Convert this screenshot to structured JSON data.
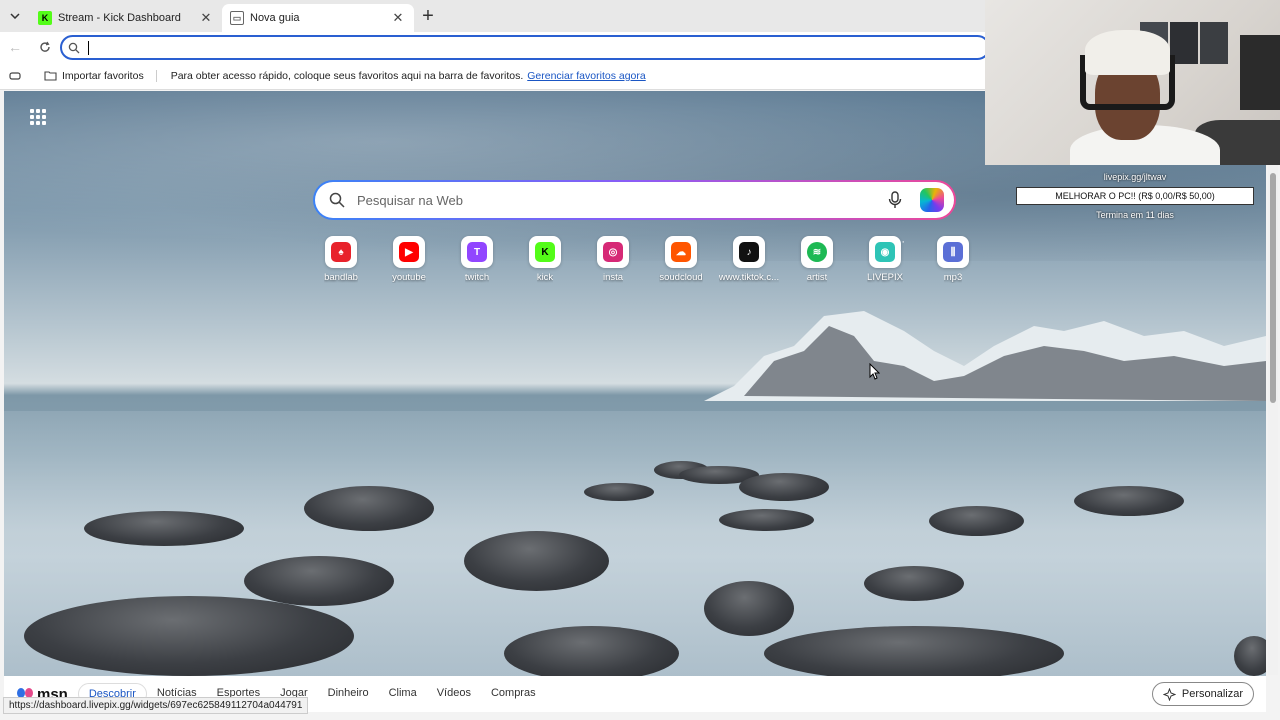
{
  "tabs": [
    {
      "title": "Stream - Kick Dashboard",
      "active": false
    },
    {
      "title": "Nova guia",
      "active": true
    }
  ],
  "address_bar": {
    "value": ""
  },
  "favorites_bar": {
    "import_label": "Importar favoritos",
    "hint": "Para obter acesso rápido, coloque seus favoritos aqui na barra de favoritos.",
    "manage_link": "Gerenciar favoritos agora"
  },
  "search": {
    "placeholder": "Pesquisar na Web"
  },
  "shortcuts": [
    {
      "label": "bandlab",
      "color": "#e8222b",
      "glyph": "♠"
    },
    {
      "label": "youtube",
      "color": "#ff0000",
      "glyph": "▶"
    },
    {
      "label": "twitch",
      "color": "#9146ff",
      "glyph": "T"
    },
    {
      "label": "kick",
      "color": "#53fc18",
      "glyph": "K"
    },
    {
      "label": "insta",
      "color": "#d62976",
      "glyph": "◎"
    },
    {
      "label": "soudcloud",
      "color": "#ff5500",
      "glyph": "☁"
    },
    {
      "label": "www.tiktok.c...",
      "color": "#111111",
      "glyph": "♪"
    },
    {
      "label": "artist",
      "color": "#1db954",
      "glyph": "≋"
    },
    {
      "label": "LIVEPIX",
      "color": "#2ec4b6",
      "glyph": "◉"
    },
    {
      "label": "mp3",
      "color": "#5b6fd6",
      "glyph": "⫼"
    }
  ],
  "msn": {
    "logo": "msn",
    "nav": [
      "Descobrir",
      "Notícias",
      "Esportes",
      "Jogar",
      "Dinheiro",
      "Clima",
      "Vídeos",
      "Compras"
    ],
    "personalize": "Personalizar"
  },
  "status_url": "https://dashboard.livepix.gg/widgets/697ec625849112704a044791",
  "overlay": {
    "url": "livepix.gg/jltwav",
    "goal": "MELHORAR O PC!! (R$ 0,00/R$ 50,00)",
    "ends": "Termina em 11 dias"
  }
}
